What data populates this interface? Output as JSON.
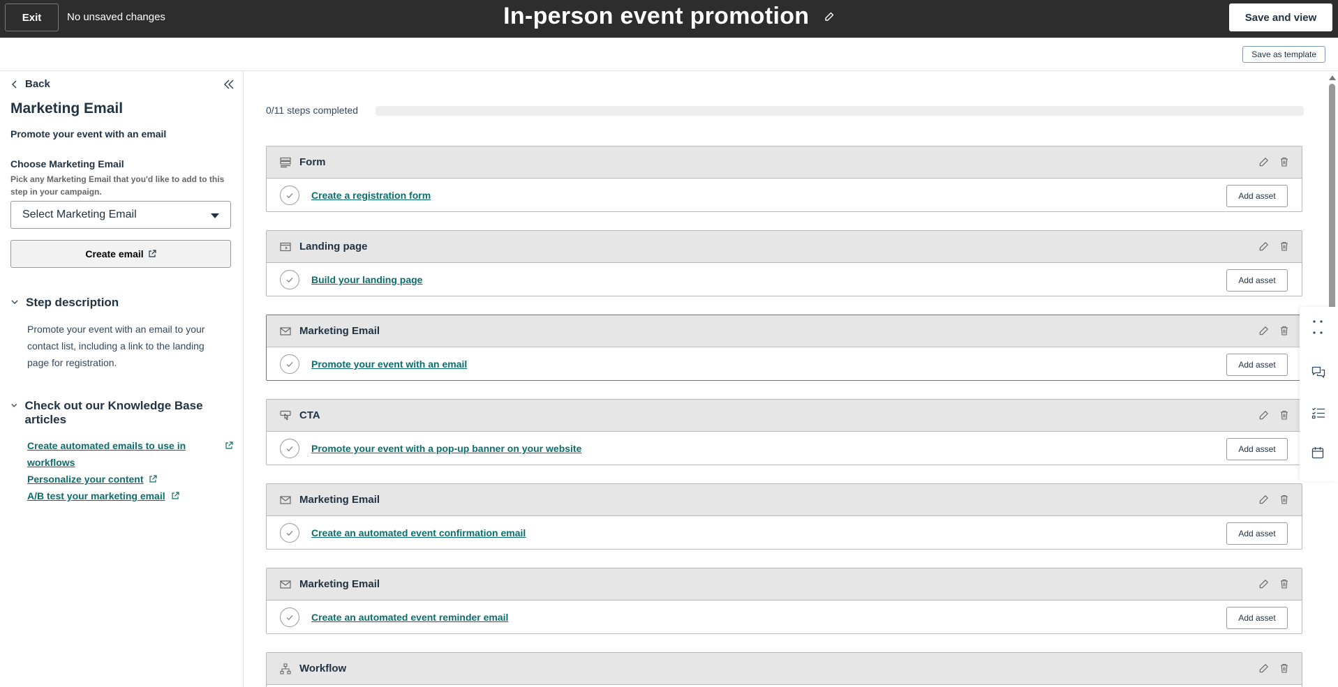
{
  "topbar": {
    "exit_label": "Exit",
    "status": "No unsaved changes",
    "title": "In-person event promotion",
    "save_view_label": "Save and view"
  },
  "subbar": {
    "save_template_label": "Save as template"
  },
  "sidebar": {
    "back_label": "Back",
    "title": "Marketing Email",
    "subtitle": "Promote your event with an email",
    "choose_label": "Choose Marketing Email",
    "choose_help": "Pick any Marketing Email that you'd like to add to this step in your campaign.",
    "select_placeholder": "Select Marketing Email",
    "create_email_label": "Create email",
    "step_description_heading": "Step description",
    "step_description": "Promote your event with an email to your contact list, including a link to the landing page for registration.",
    "kb_heading": "Check out our Knowledge Base articles",
    "kb_links": [
      "Create automated emails to use in workflows",
      "Personalize your content",
      "A/B test your marketing email"
    ]
  },
  "progress": {
    "text": "0/11 steps completed",
    "completed": 0,
    "total": 11
  },
  "steps": [
    {
      "type": "Form",
      "icon": "form-icon",
      "task": "Create a registration form",
      "button": "Add asset"
    },
    {
      "type": "Landing page",
      "icon": "landing-page-icon",
      "task": "Build your landing page",
      "button": "Add asset"
    },
    {
      "type": "Marketing Email",
      "icon": "email-icon",
      "task": "Promote your event with an email",
      "button": "Add asset",
      "selected": true
    },
    {
      "type": "CTA",
      "icon": "cta-icon",
      "task": "Promote your event with a pop-up banner on your website",
      "button": "Add asset"
    },
    {
      "type": "Marketing Email",
      "icon": "email-icon",
      "task": "Create an automated event confirmation email",
      "button": "Add asset"
    },
    {
      "type": "Marketing Email",
      "icon": "email-icon",
      "task": "Create an automated event reminder email",
      "button": "Add asset"
    },
    {
      "type": "Workflow",
      "icon": "workflow-icon",
      "task": "",
      "button": ""
    }
  ],
  "colors": {
    "topbar": "#2d2d2d",
    "link": "#0b6e6e",
    "selected_border": "#3b7fc7",
    "card_header": "#e6e6e6"
  }
}
